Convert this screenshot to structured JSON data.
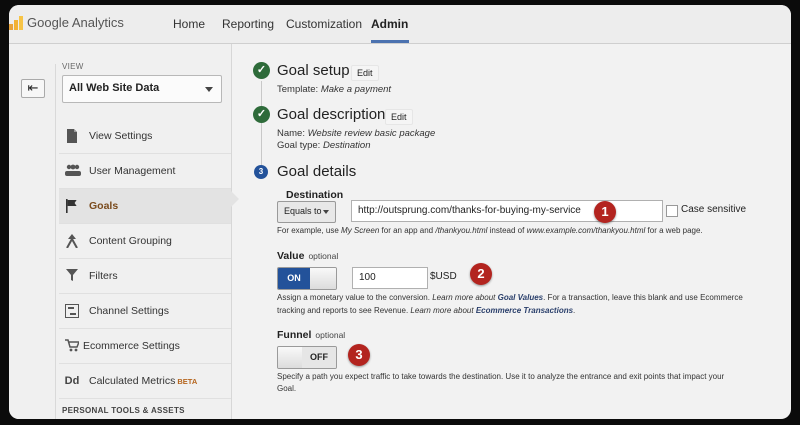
{
  "app": {
    "name": "Google Analytics"
  },
  "nav": {
    "home": "Home",
    "reporting": "Reporting",
    "customization": "Customization",
    "admin": "Admin"
  },
  "sidebar": {
    "view_label": "VIEW",
    "view_value": "All Web Site Data",
    "items": [
      {
        "label": "View Settings",
        "icon": "document-icon"
      },
      {
        "label": "User Management",
        "icon": "users-icon"
      },
      {
        "label": "Goals",
        "icon": "flag-icon"
      },
      {
        "label": "Content Grouping",
        "icon": "grouping-icon"
      },
      {
        "label": "Filters",
        "icon": "filter-icon"
      },
      {
        "label": "Channel Settings",
        "icon": "channel-icon"
      },
      {
        "label": "Ecommerce Settings",
        "icon": "cart-icon"
      },
      {
        "label": "Calculated Metrics",
        "icon": "dd-icon",
        "badge": "BETA"
      }
    ],
    "active_index": 2,
    "section_label": "PERSONAL TOOLS & ASSETS"
  },
  "steps": {
    "setup": {
      "title": "Goal setup",
      "edit": "Edit",
      "template_label": "Template:",
      "template_value": "Make a payment"
    },
    "description": {
      "title": "Goal description",
      "edit": "Edit",
      "name_label": "Name:",
      "name_value": "Website review basic package",
      "type_label": "Goal type:",
      "type_value": "Destination"
    },
    "details": {
      "number": "3",
      "title": "Goal details"
    }
  },
  "destination": {
    "label": "Destination",
    "match_type": "Equals to",
    "url": "http://outsprung.com/thanks-for-buying-my-service",
    "case_sensitive": "Case sensitive",
    "help_prefix": "For example, use",
    "help_my_screen": "My Screen",
    "help_mid": "for an app and",
    "help_thankyou": "/thankyou.html",
    "help_instead": "instead of",
    "help_example": "www.example.com/thankyou.html",
    "help_suffix": "for a web page."
  },
  "value": {
    "label": "Value",
    "optional": "optional",
    "toggle": "ON",
    "amount": "100",
    "currency": "$USD",
    "help1_a": "Assign a monetary value to the conversion.",
    "help1_b": "Learn more about",
    "help1_c": "Goal Values",
    "help1_d": ". For a transaction, leave this blank and use Ecommerce",
    "help2_a": "tracking and reports to see Revenue.",
    "help2_b": "Learn more about",
    "help2_c": "Ecommerce Transactions",
    "help2_d": "."
  },
  "funnel": {
    "label": "Funnel",
    "optional": "optional",
    "toggle": "OFF",
    "help1": "Specify a path you expect traffic to take towards the destination. Use it to analyze the entrance and exit points that impact your",
    "help2": "Goal."
  },
  "badges": [
    "1",
    "2",
    "3"
  ],
  "colors": {
    "accent": "#23529a",
    "check": "#2e6b3a",
    "badge": "#b3241f"
  }
}
